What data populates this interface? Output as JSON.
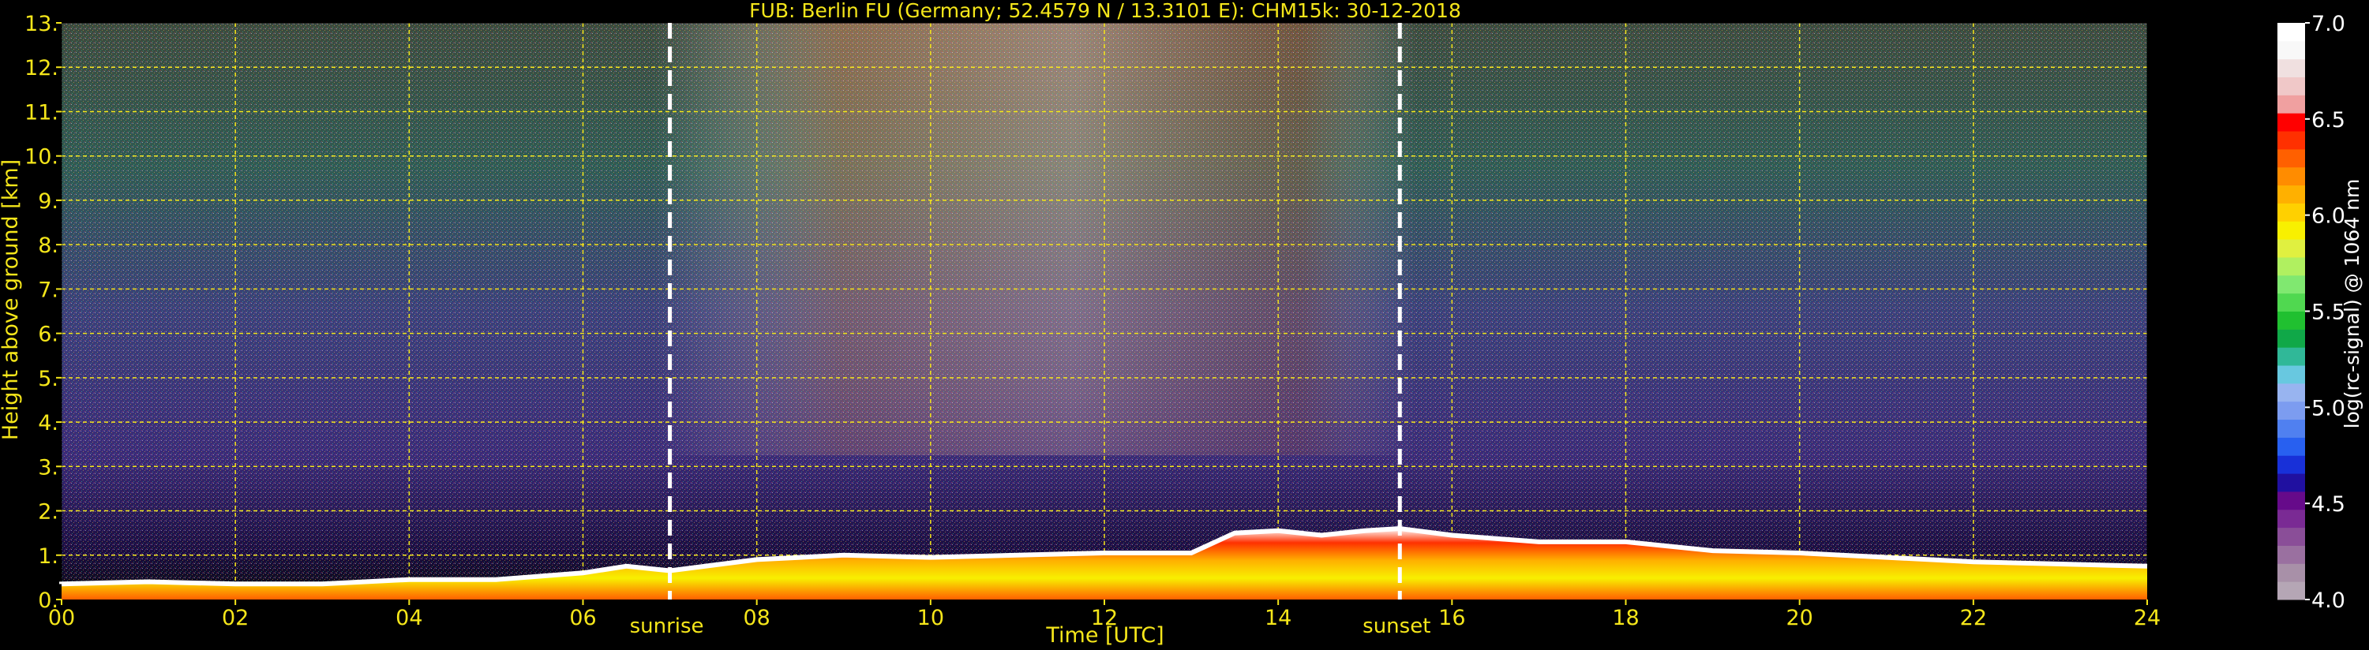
{
  "chart_data": {
    "type": "heatmap",
    "title": "FUB: Berlin FU (Germany; 52.4579 N / 13.3101 E):    CHM15k: 30-12-2018",
    "xlabel": "Time [UTC]",
    "ylabel": "Height above ground [km]",
    "xlim": [
      0,
      24
    ],
    "ylim": [
      0,
      13
    ],
    "x_ticks": [
      "00",
      "02",
      "04",
      "06",
      "08",
      "10",
      "12",
      "14",
      "16",
      "18",
      "20",
      "22",
      "24"
    ],
    "y_ticks": [
      "0.",
      "1.",
      "2.",
      "3.",
      "4.",
      "5.",
      "6.",
      "7.",
      "8.",
      "9.",
      "10.",
      "11.",
      "12.",
      "13."
    ],
    "grid": true,
    "grid_color": "#f5e61a",
    "annotations": [
      {
        "label": "sunrise",
        "x": 7.0
      },
      {
        "label": "sunset",
        "x": 15.4
      }
    ],
    "boundary_layer_top_km": [
      [
        0.0,
        0.35
      ],
      [
        1.0,
        0.4
      ],
      [
        2.0,
        0.35
      ],
      [
        3.0,
        0.35
      ],
      [
        4.0,
        0.45
      ],
      [
        5.0,
        0.45
      ],
      [
        6.0,
        0.6
      ],
      [
        6.5,
        0.75
      ],
      [
        7.0,
        0.65
      ],
      [
        8.0,
        0.9
      ],
      [
        9.0,
        1.0
      ],
      [
        10.0,
        0.95
      ],
      [
        11.0,
        1.0
      ],
      [
        12.0,
        1.05
      ],
      [
        13.0,
        1.05
      ],
      [
        13.5,
        1.5
      ],
      [
        14.0,
        1.55
      ],
      [
        14.5,
        1.45
      ],
      [
        15.0,
        1.55
      ],
      [
        15.4,
        1.6
      ],
      [
        16.0,
        1.45
      ],
      [
        17.0,
        1.3
      ],
      [
        18.0,
        1.3
      ],
      [
        19.0,
        1.1
      ],
      [
        20.0,
        1.05
      ],
      [
        21.0,
        0.95
      ],
      [
        22.0,
        0.85
      ],
      [
        23.0,
        0.8
      ],
      [
        24.0,
        0.75
      ]
    ],
    "colorbar": {
      "label": "log(rc-signal) @ 1064 nm",
      "range": [
        4.0,
        7.0
      ],
      "ticks": [
        "4.0",
        "4.5",
        "5.0",
        "5.5",
        "6.0",
        "6.5",
        "7.0"
      ],
      "colors": [
        "#b5a6b5",
        "#a890a8",
        "#9a70a0",
        "#8a4e98",
        "#7a2a94",
        "#660a8a",
        "#2010a0",
        "#1830d8",
        "#2860f0",
        "#5080f0",
        "#7c9cf0",
        "#98b4f0",
        "#68c8e0",
        "#30b898",
        "#10a848",
        "#20c030",
        "#50d850",
        "#80e870",
        "#b0f060",
        "#e0f040",
        "#f8f000",
        "#ffd000",
        "#ffb000",
        "#ff8c00",
        "#ff6000",
        "#ff3000",
        "#ff0000",
        "#f0a0a0",
        "#f0c8c8",
        "#f0e0e0",
        "#f8f8f8",
        "#ffffff"
      ]
    }
  }
}
